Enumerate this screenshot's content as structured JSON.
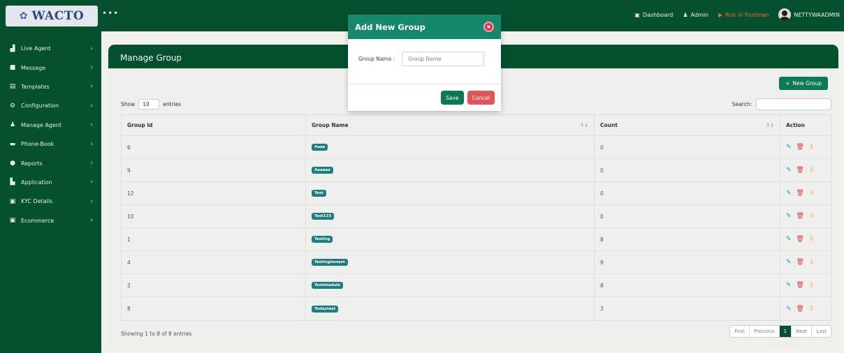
{
  "brand": {
    "logo_text": "WACTO"
  },
  "topnav": {
    "dashboard": "Dashboard",
    "admin": "Admin",
    "postman": "Run in Postman",
    "user": "NETTYWAADMIN"
  },
  "sidebar": {
    "items": [
      {
        "label": "Live Agent",
        "icon": "building-icon"
      },
      {
        "label": "Message",
        "icon": "message-icon"
      },
      {
        "label": "Templates",
        "icon": "template-icon"
      },
      {
        "label": "Configuration",
        "icon": "gears-icon"
      },
      {
        "label": "Manage Agent",
        "icon": "users-icon"
      },
      {
        "label": "Phone-Book",
        "icon": "phonebook-icon"
      },
      {
        "label": "Reports",
        "icon": "reports-icon"
      },
      {
        "label": "Application",
        "icon": "application-icon"
      },
      {
        "label": "KYC Details",
        "icon": "kyc-icon"
      },
      {
        "label": "Ecommerce",
        "icon": "ecommerce-icon"
      }
    ]
  },
  "page": {
    "title": "Manage Group",
    "new_group_label": "New Group",
    "show_label": "Show",
    "entries_value": "10",
    "entries_label": "entries",
    "search_label": "Search:",
    "info": "Showing 1 to 8 of 8 entries"
  },
  "table": {
    "headers": {
      "id": "Group Id",
      "name": "Group Name",
      "count": "Count",
      "action": "Action"
    },
    "rows": [
      {
        "id": "6",
        "name": "Aaaa",
        "count": "0"
      },
      {
        "id": "9",
        "name": "Aaaaaa",
        "count": "0"
      },
      {
        "id": "12",
        "name": "Test",
        "count": "0"
      },
      {
        "id": "10",
        "name": "Test123",
        "count": "0"
      },
      {
        "id": "1",
        "name": "Testing",
        "count": "8"
      },
      {
        "id": "4",
        "name": "Testinghonest",
        "count": "9"
      },
      {
        "id": "2",
        "name": "Testshedule",
        "count": "8"
      },
      {
        "id": "8",
        "name": "Todaytest",
        "count": "3"
      }
    ]
  },
  "pagination": {
    "first": "First",
    "previous": "Previous",
    "current": "1",
    "next": "Next",
    "last": "Last"
  },
  "modal": {
    "title": "Add New Group",
    "field_label": "Group Name :",
    "placeholder": "Group Name",
    "save": "Save",
    "cancel": "Cancel"
  },
  "colors": {
    "primary": "#05512f",
    "accent": "#0c7a52",
    "danger": "#e05555",
    "pill": "#207d7d"
  }
}
